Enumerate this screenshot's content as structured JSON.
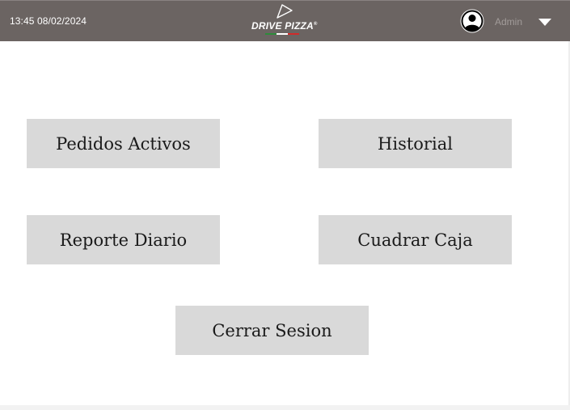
{
  "header": {
    "datetime": "13:45 08/02/2024",
    "logo_text": "DRIVE PIZZA",
    "logo_mark": "®",
    "user_icon": "account-circle-icon",
    "user_name": "Admin",
    "dropdown_icon": "caret-down-icon",
    "colors": {
      "background": "#6b6462",
      "logo_green": "#2e8b3a",
      "logo_white": "#ffffff",
      "logo_red": "#d22a2a"
    }
  },
  "menu": {
    "pedidos_activos": "Pedidos Activos",
    "historial": "Historial",
    "reporte_diario": "Reporte Diario",
    "cuadrar_caja": "Cuadrar Caja",
    "cerrar_sesion": "Cerrar Sesion",
    "button_color": "#d9d9d9"
  }
}
